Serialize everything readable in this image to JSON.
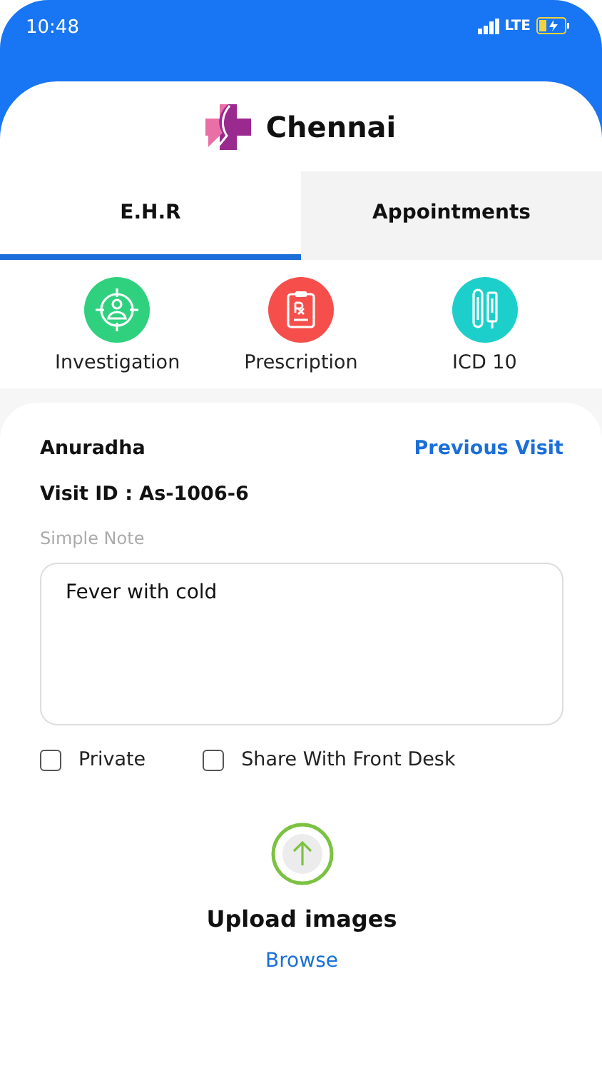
{
  "status_bar": {
    "time": "10:48",
    "network": "LTE"
  },
  "header": {
    "title": "Chennai"
  },
  "tabs": [
    {
      "label": "E.H.R",
      "selected": true
    },
    {
      "label": "Appointments",
      "selected": false
    }
  ],
  "shortcuts": [
    {
      "label": "Investigation",
      "kind": "investigation",
      "color": "#2fd17f"
    },
    {
      "label": "Prescription",
      "kind": "prescription",
      "color": "#f64f4b"
    },
    {
      "label": "ICD 10",
      "kind": "icd",
      "color": "#1dcfcb"
    }
  ],
  "patient": {
    "name": "Anuradha",
    "link": "Previous Visit",
    "visit_id": "Visit ID : As-1006-6"
  },
  "note": {
    "label": "Simple Note",
    "value": "Fever with cold"
  },
  "options": [
    {
      "label": "Private",
      "checked": false
    },
    {
      "label": "Share With Front Desk",
      "checked": false
    }
  ],
  "upload": {
    "title": "Upload images",
    "link": "Browse"
  }
}
